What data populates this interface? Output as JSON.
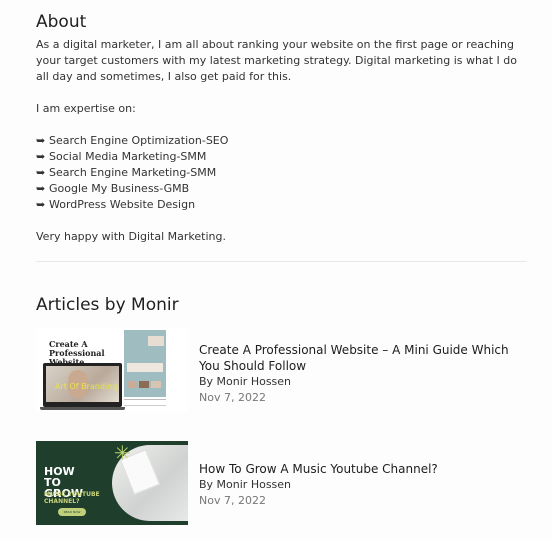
{
  "about": {
    "title": "About",
    "paragraph": "As a digital marketer, I am all about ranking your website on the first page or reaching your target customers with my latest marketing strategy. Digital marketing is what I do all day and sometimes, I also get paid for this.",
    "expertise_intro": "I am expertise on:",
    "bullet_glyph": "➥",
    "expertise": [
      "Search Engine Optimization-SEO",
      "Social Media Marketing-SMM",
      "Search Engine Marketing-SMM",
      "Google My Business-GMB",
      "WordPress Website Design"
    ],
    "closing": "Very happy with Digital Marketing."
  },
  "articles": {
    "title": "Articles by Monir",
    "items": [
      {
        "title": "Create A Professional Website – A Mini Guide Which You Should Follow",
        "author": "By Monir Hossen",
        "date": "Nov 7, 2022",
        "thumbnail": {
          "headline": "Create A Professional Website",
          "screen_text": "Art Of Branding"
        }
      },
      {
        "title": "How To Grow A Music Youtube Channel?",
        "author": "By Monir Hossen",
        "date": "Nov 7, 2022",
        "thumbnail": {
          "headline": "HOW TO GROW",
          "subheadline": "MUSIC YOUTUBE CHANNEL?",
          "button": "READ NOW"
        }
      }
    ]
  },
  "colors": {
    "background": "#fcfdfc",
    "text": "#333333",
    "date": "#777777",
    "divider": "#e8e8e8",
    "thumb2_bg": "#1f3f2c",
    "thumb2_accent": "#c8d37a"
  }
}
